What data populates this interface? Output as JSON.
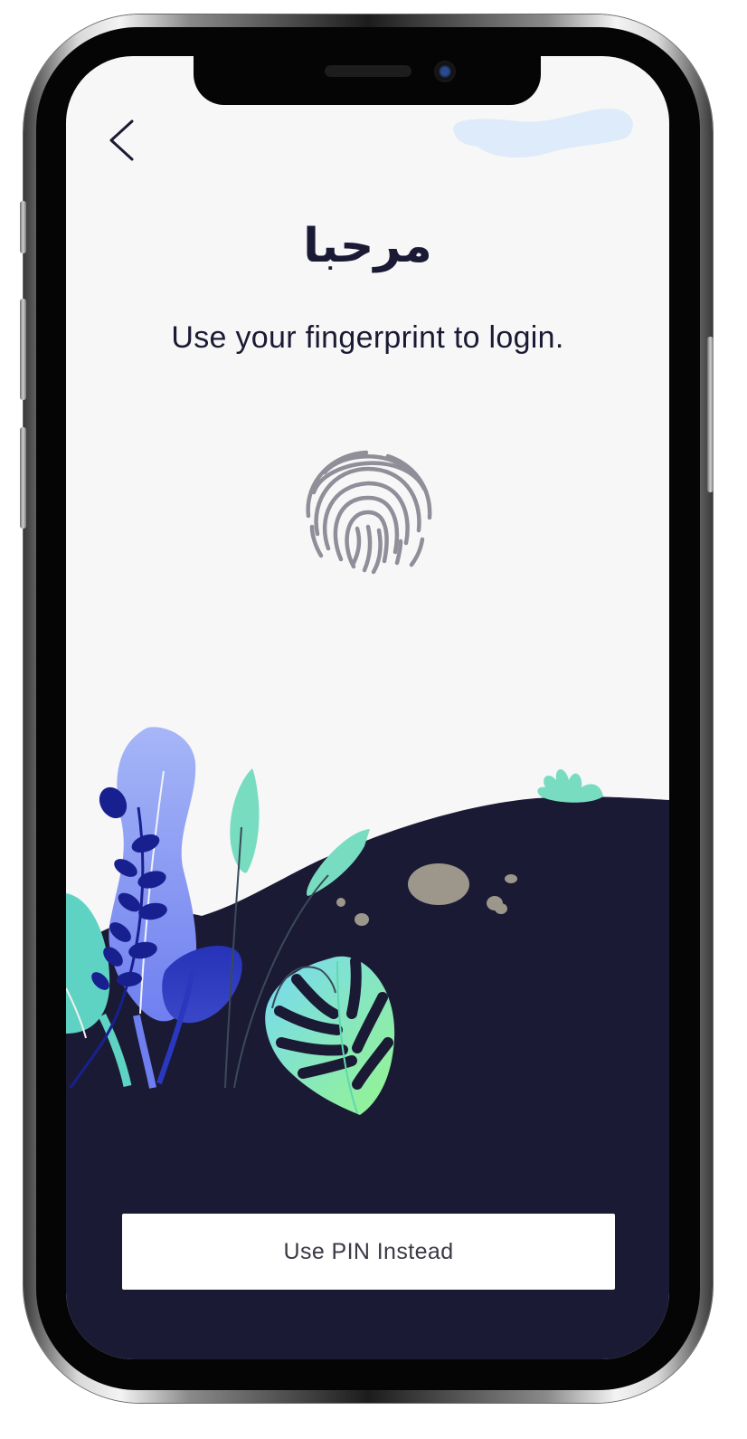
{
  "screen": {
    "title": "مرحبا",
    "subtitle": "Use your fingerprint to login.",
    "pin_button_label": "Use PIN Instead"
  },
  "icons": {
    "back": "chevron-left-icon",
    "fingerprint": "fingerprint-icon"
  },
  "colors": {
    "background": "#f7f7f7",
    "ground": "#1b1a35",
    "text": "#1b1a35",
    "fingerprint": "#8f8e99",
    "button_bg": "#ffffff"
  }
}
